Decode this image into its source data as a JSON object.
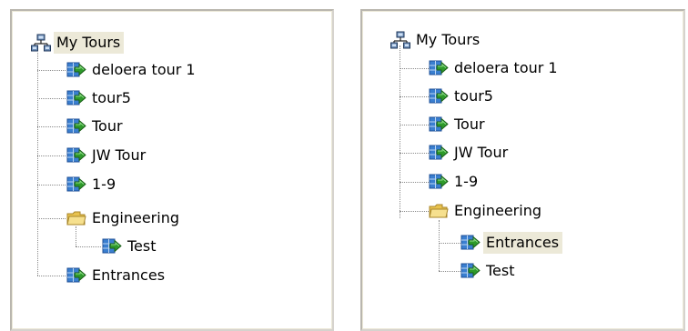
{
  "left_tree": {
    "root": {
      "label": "My Tours",
      "icon": "network-computers-icon"
    },
    "items": [
      {
        "label": "deloera tour 1",
        "icon": "tour-arrow-icon"
      },
      {
        "label": "tour5",
        "icon": "tour-arrow-icon"
      },
      {
        "label": "Tour",
        "icon": "tour-arrow-icon"
      },
      {
        "label": "JW Tour",
        "icon": "tour-arrow-icon"
      },
      {
        "label": "1-9",
        "icon": "tour-arrow-icon"
      },
      {
        "label": "Engineering",
        "icon": "folder-open-icon"
      },
      {
        "label": "Test",
        "icon": "tour-arrow-icon"
      },
      {
        "label": "Entrances",
        "icon": "tour-arrow-icon"
      }
    ],
    "selected_label": "My Tours"
  },
  "right_tree": {
    "root": {
      "label": "My Tours",
      "icon": "network-computers-icon"
    },
    "items": [
      {
        "label": "deloera tour 1",
        "icon": "tour-arrow-icon"
      },
      {
        "label": "tour5",
        "icon": "tour-arrow-icon"
      },
      {
        "label": "Tour",
        "icon": "tour-arrow-icon"
      },
      {
        "label": "JW Tour",
        "icon": "tour-arrow-icon"
      },
      {
        "label": "1-9",
        "icon": "tour-arrow-icon"
      },
      {
        "label": "Engineering",
        "icon": "folder-open-icon"
      },
      {
        "label": "Entrances",
        "icon": "tour-arrow-icon"
      },
      {
        "label": "Test",
        "icon": "tour-arrow-icon"
      }
    ],
    "selected_label": "Entrances"
  },
  "colors": {
    "selection_bg": "#ece9d8",
    "tour_icon_blue": "#3a7fd0",
    "tour_icon_arrow": "#2e9a2a",
    "folder_yellow": "#f2d46a"
  }
}
